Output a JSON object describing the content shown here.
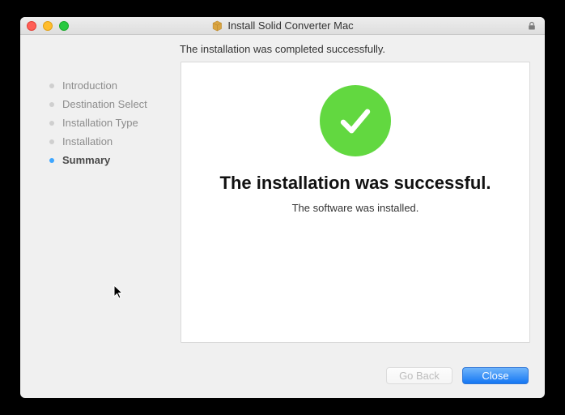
{
  "window": {
    "title": "Install Solid Converter Mac"
  },
  "subtitle": "The installation was completed successfully.",
  "sidebar": {
    "items": [
      {
        "label": "Introduction"
      },
      {
        "label": "Destination Select"
      },
      {
        "label": "Installation Type"
      },
      {
        "label": "Installation"
      },
      {
        "label": "Summary"
      }
    ]
  },
  "main": {
    "heading": "The installation was successful.",
    "subtext": "The software was installed."
  },
  "footer": {
    "go_back_label": "Go Back",
    "close_label": "Close"
  }
}
